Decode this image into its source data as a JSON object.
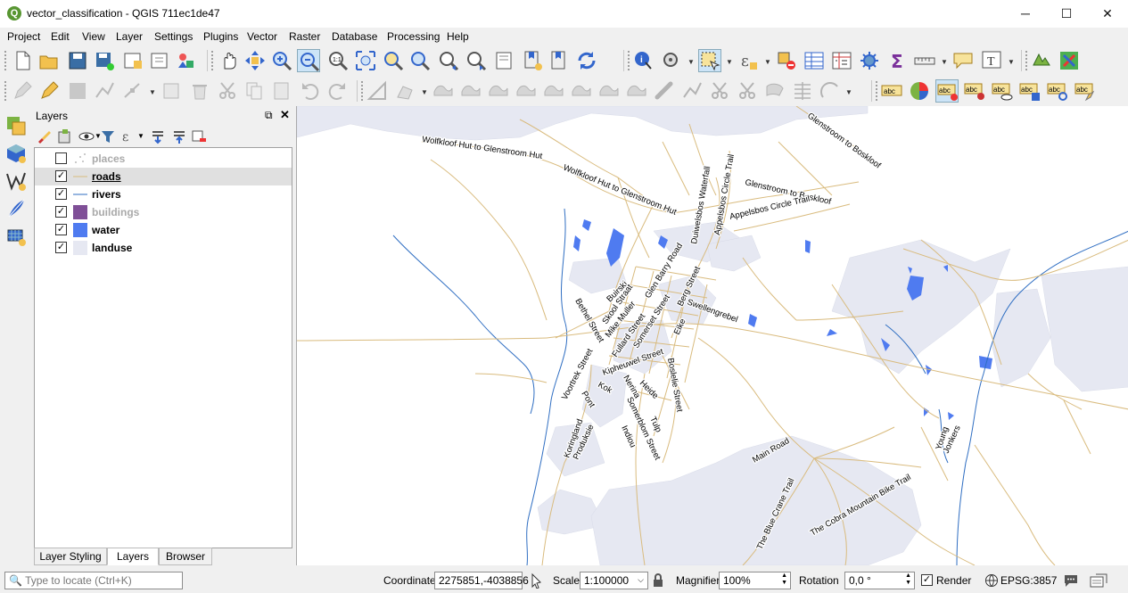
{
  "window": {
    "title": "vector_classification - QGIS 711ec1de47",
    "minimize_glyph": "─",
    "maximize_glyph": "☐",
    "close_glyph": "✕"
  },
  "menu": [
    "Project",
    "Edit",
    "View",
    "Layer",
    "Settings",
    "Plugins",
    "Vector",
    "Raster",
    "Database",
    "Processing",
    "Help"
  ],
  "layers_panel": {
    "title": "Layers",
    "float_glyph": "⧉",
    "close_glyph": "✕",
    "layers": [
      {
        "name": "places",
        "checked": false,
        "symbol": "point",
        "style": "dim"
      },
      {
        "name": "roads",
        "checked": true,
        "symbol": "line-road",
        "style": "underline",
        "selected": true
      },
      {
        "name": "rivers",
        "checked": true,
        "symbol": "line-river",
        "style": "normal"
      },
      {
        "name": "buildings",
        "checked": true,
        "symbol": "fill-purple",
        "style": "dim"
      },
      {
        "name": "water",
        "checked": true,
        "symbol": "fill-blue",
        "style": "normal"
      },
      {
        "name": "landuse",
        "checked": true,
        "symbol": "fill-grey",
        "style": "normal"
      }
    ],
    "check_glyph": "✓",
    "tabs": [
      "Layer Styling",
      "Layers",
      "Browser"
    ],
    "active_tab": "Layers"
  },
  "map_labels": {
    "wolfkloof1": "Wolfkloof Hut to Glenstroom Hut",
    "wolfkloof2": "Wolfkloof Hut to Glenstroom Hut",
    "glenstroom_boskloof1": "Glenstroom to Boskloof",
    "glenstroom_boskloof2": "Glenstroom to Boskloof",
    "duiwelsbos": "Duiwelsbos Waterfall",
    "appelsbos1": "Appelsbos Circle Trail",
    "appelsbos2": "Appelsbos Circle Trail",
    "buirski": "Buirski",
    "glen_barry": "Glen Barry Road",
    "berg": "Berg Street",
    "skool": "Skool Straat",
    "bethel": "Bethel Street",
    "mike_muller": "Mike Muller",
    "somerset": "Somerset Street",
    "swellengrebel": "Swellengrebel",
    "fullard": "Fullard Street",
    "eike": "Eike",
    "kipheuwel": "Kipheuwel Street",
    "voortrek": "Voortrek Street",
    "boslelie": "Boslelie Street",
    "kok": "Kok",
    "nerina": "Nerina",
    "heide": "Heide",
    "pont": "Pont",
    "somerblom": "Somerblom Street",
    "tulp": "Tulp",
    "indiou": "Indiou",
    "koringland": "Koringland",
    "produksie": "Produksie",
    "main_road": "Main Road",
    "young": "Young",
    "jonkers": "Jonkers",
    "blue_crane": "The Blue Crane Trail",
    "cobra": "The Cobra Mountain Bike Trail"
  },
  "statusbar": {
    "locator_placeholder": "Type to locate (Ctrl+K)",
    "coordinate_label": "Coordinate",
    "coordinate_value": "2275851,-4038856",
    "scale_label": "Scale",
    "scale_value": "1:100000",
    "magnifier_label": "Magnifier",
    "magnifier_value": "100%",
    "rotation_label": "Rotation",
    "rotation_value": "0,0 °",
    "render_label": "Render",
    "render_checked": true,
    "crs": "EPSG:3857"
  },
  "colors": {
    "landuse": "#e6e8f2",
    "water": "#4f7bf0",
    "rivers": "#2f6ec2",
    "roads": "#d9bb7e",
    "buildings": "#7f4f97",
    "qgis_green": "#589632"
  }
}
